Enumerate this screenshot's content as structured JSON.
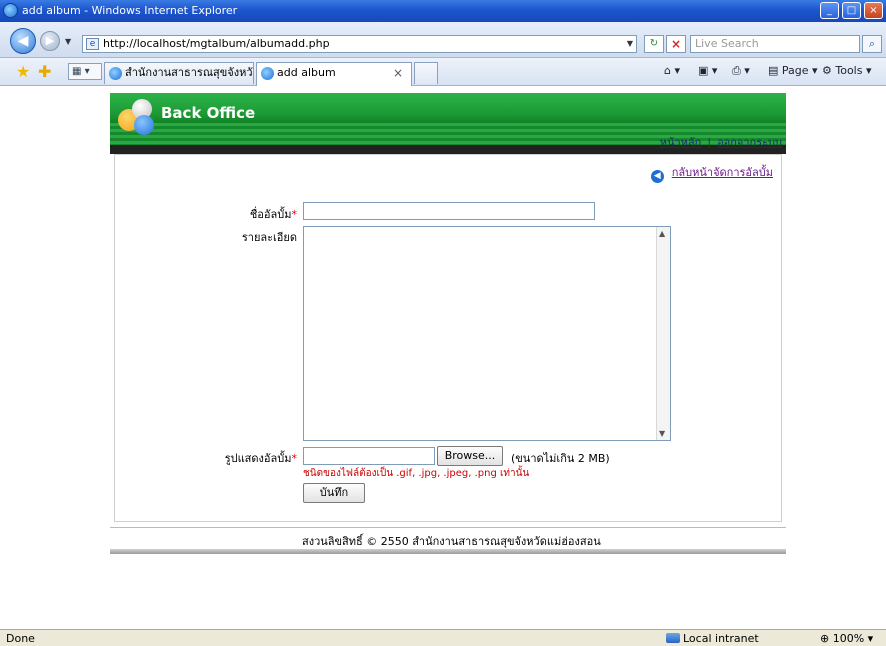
{
  "window": {
    "title": "add album - Windows Internet Explorer",
    "minimize_icon": "minimize-icon",
    "maximize_icon": "maximize-icon",
    "close_icon": "close-icon"
  },
  "addressbar": {
    "url": "http://localhost/mgtalbum/albumadd.php",
    "search_placeholder": "Live Search"
  },
  "tabs": [
    {
      "label": "สำนักงานสาธารณสุขจังหวัด...",
      "active": false
    },
    {
      "label": "add album",
      "active": true
    }
  ],
  "commandbar": {
    "page_label": "Page",
    "tools_label": "Tools"
  },
  "header": {
    "brand": "Back Office"
  },
  "topnav": {
    "home": "หน้าหลัก",
    "separator": "|",
    "logout": "ออกจากระบบ"
  },
  "form": {
    "back_link": "กลับหน้าจัดการอัลบั้ม",
    "album_name_label": "ชื่ออัลบั้ม",
    "required_mark": "*",
    "description_label": "รายละเอียด",
    "cover_label": "รูปแสดงอัลบั้ม",
    "browse_button": "Browse...",
    "size_note": "(ขนาดไม่เกิน 2 MB)",
    "type_note": "ชนิดของไฟล์ต้องเป็น .gif, .jpg, .jpeg, .png เท่านั้น",
    "save_button": "บันทึก"
  },
  "footer": {
    "copyright": "สงวนลิขสิทธิ์ © 2550 สำนักงานสาธารณสุขจังหวัดแม่ฮ่องสอน"
  },
  "statusbar": {
    "status": "Done",
    "zone": "Local intranet",
    "zoom": "100%"
  },
  "colors": {
    "header_green": "#1c9a35",
    "link_purple": "#6a1a8a",
    "required_red": "#d00000"
  }
}
